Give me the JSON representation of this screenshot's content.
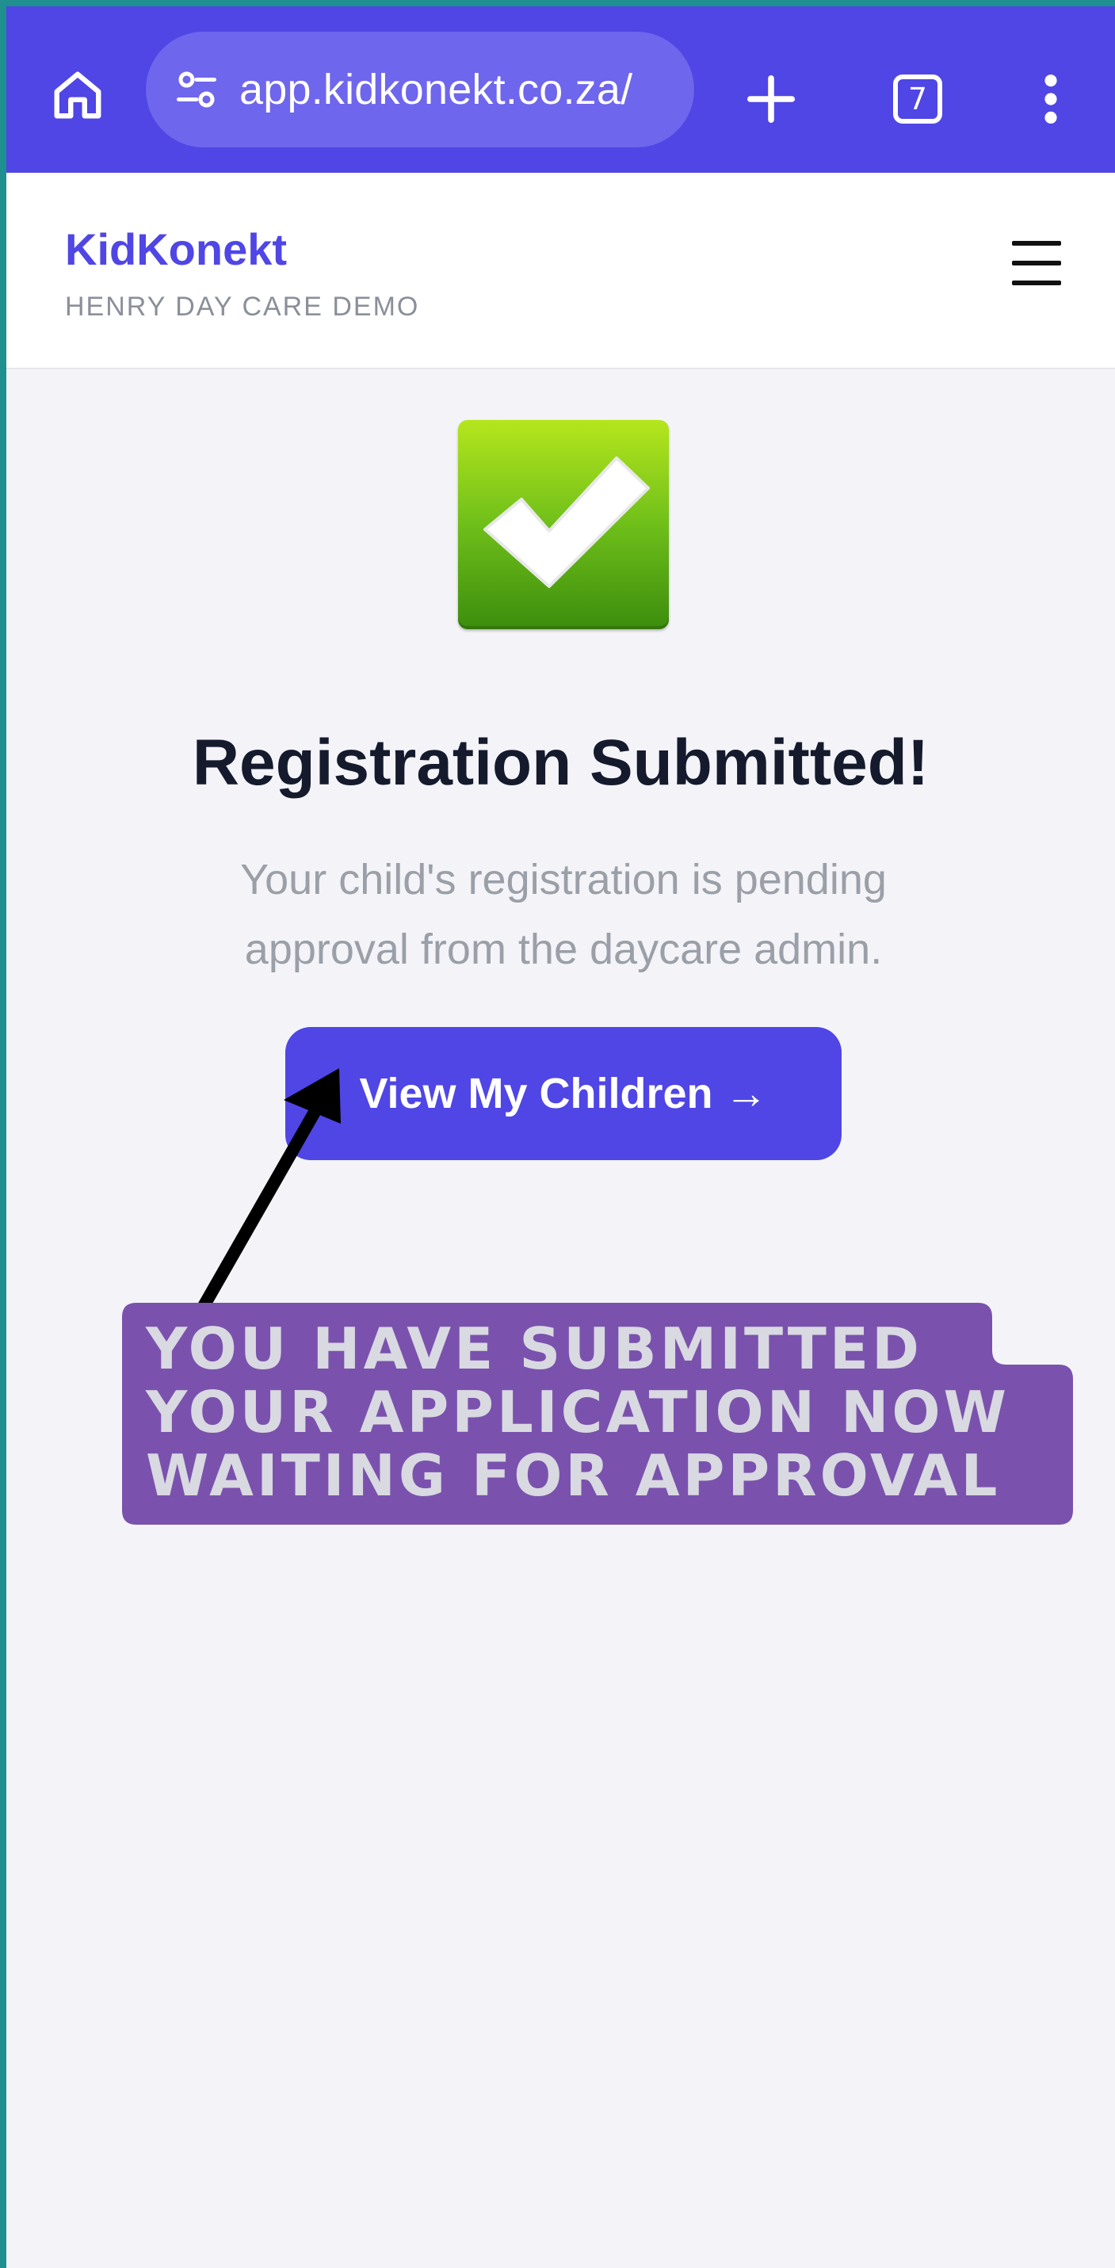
{
  "browser": {
    "url": "app.kidkonekt.co.za/",
    "tab_count": "7",
    "icons": [
      "home-icon",
      "site-settings-icon",
      "plus-icon",
      "tab-switcher-icon",
      "more-vert-icon"
    ]
  },
  "header": {
    "brand": "KidKonekt",
    "subtitle": "HENRY DAY CARE DEMO",
    "menu_icon": "hamburger-menu-icon"
  },
  "main": {
    "status_icon": "check-mark-icon",
    "title": "Registration Submitted!",
    "message": "Your child's registration is pending approval from the daycare admin.",
    "button_label": "View My Children →"
  },
  "annotation": {
    "text": "YOU HAVE SUBMITTED\nYOUR APPLICATION NOW\nWAITING FOR APPROVAL",
    "pointer_icon": "arrow-icon"
  },
  "colors": {
    "accent": "#4f46e5",
    "annotation_bg": "#7a52ad",
    "success": "#6fbf1a"
  }
}
